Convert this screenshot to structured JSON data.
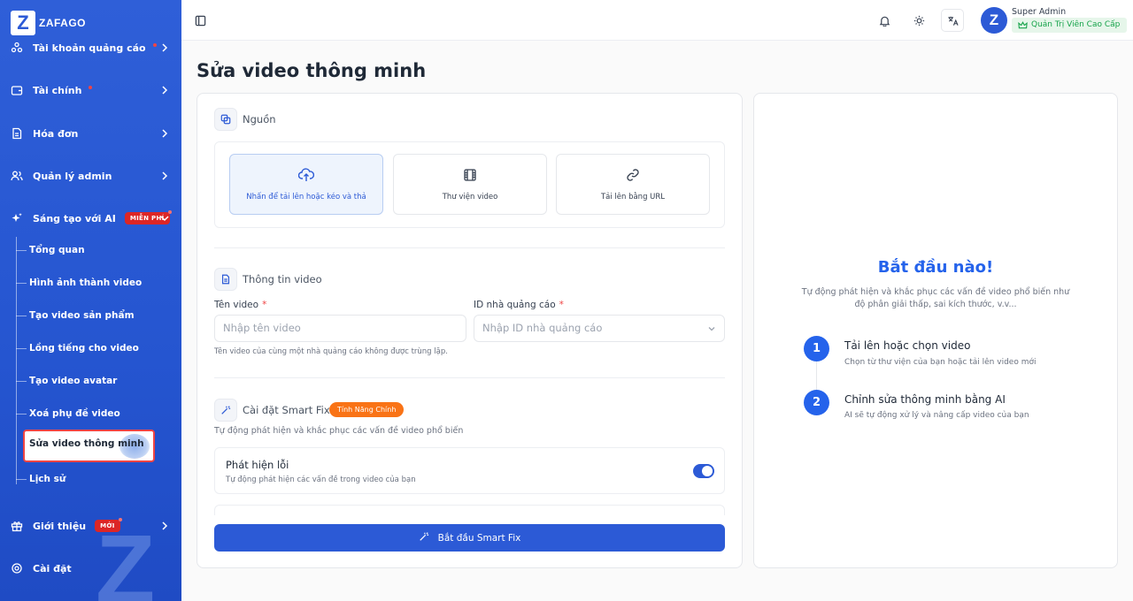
{
  "brand": {
    "logo_letter": "Z",
    "name": "ZAFAGO"
  },
  "sidebar": {
    "items": [
      {
        "label": "Tài khoản quảng cáo"
      },
      {
        "label": "Tài chính"
      },
      {
        "label": "Hóa đơn"
      },
      {
        "label": "Quản lý admin"
      },
      {
        "label": "Sáng tạo với AI",
        "badge": "MIỄN PHÍ"
      },
      {
        "label": "Giới thiệu",
        "badge": "MỚI"
      },
      {
        "label": "Cài đặt"
      }
    ],
    "sub_items": [
      {
        "label": "Tổng quan"
      },
      {
        "label": "Hình ảnh thành video"
      },
      {
        "label": "Tạo video sản phẩm"
      },
      {
        "label": "Lồng tiếng cho video"
      },
      {
        "label": "Tạo video avatar"
      },
      {
        "label": "Xoá phụ đề video"
      },
      {
        "label": "Sửa video thông minh"
      },
      {
        "label": "Lịch sử"
      }
    ],
    "active_sub": "Sửa video thông minh"
  },
  "topbar": {
    "user_name": "Super Admin",
    "user_role": "Quản Trị Viên Cao Cấp",
    "avatar_letter": "Z"
  },
  "page": {
    "title": "Sửa video thông minh"
  },
  "source": {
    "title": "Nguồn",
    "options": [
      {
        "label": "Nhấn để tải lên hoặc kéo và thả",
        "icon": "upload-cloud-icon",
        "active": true
      },
      {
        "label": "Thư viện video",
        "icon": "film-icon",
        "active": false
      },
      {
        "label": "Tải lên bằng URL",
        "icon": "link-icon",
        "active": false
      }
    ]
  },
  "video_info": {
    "title": "Thông tin video",
    "name_label": "Tên video",
    "name_placeholder": "Nhập tên video",
    "name_hint": "Tên video của cùng một nhà quảng cáo không được trùng lặp.",
    "advertiser_label": "ID nhà quảng cáo",
    "advertiser_placeholder": "Nhập ID nhà quảng cáo"
  },
  "smart_fix": {
    "title": "Cài đặt Smart Fix",
    "badge": "Tính Năng Chính",
    "description": "Tự động phát hiện và khắc phục các vấn đề video phổ biến",
    "toggle_title": "Phát hiện lỗi",
    "toggle_desc": "Tự động phát hiện các vấn đề trong video của bạn",
    "toggle_on": true,
    "cta": "Bắt đầu Smart Fix"
  },
  "right_panel": {
    "heading": "Bắt đầu nào!",
    "subtitle_line1": "Tự động phát hiện và khắc phục các vấn đề video phổ biến như",
    "subtitle_line2": "độ phân giải thấp, sai kích thước, v.v...",
    "steps": [
      {
        "num": "1",
        "title": "Tải lên hoặc chọn video",
        "desc": "Chọn từ thư viện của bạn hoặc tải lên video mới"
      },
      {
        "num": "2",
        "title": "Chỉnh sửa thông minh bằng AI",
        "desc": "AI sẽ tự động xử lý và nâng cấp video của bạn"
      }
    ]
  },
  "colors": {
    "primary": "#2c5ad6",
    "sidebar": "#2555d0",
    "badge_red": "#dc2626",
    "badge_orange": "#f97316",
    "success": "#16a34a"
  }
}
